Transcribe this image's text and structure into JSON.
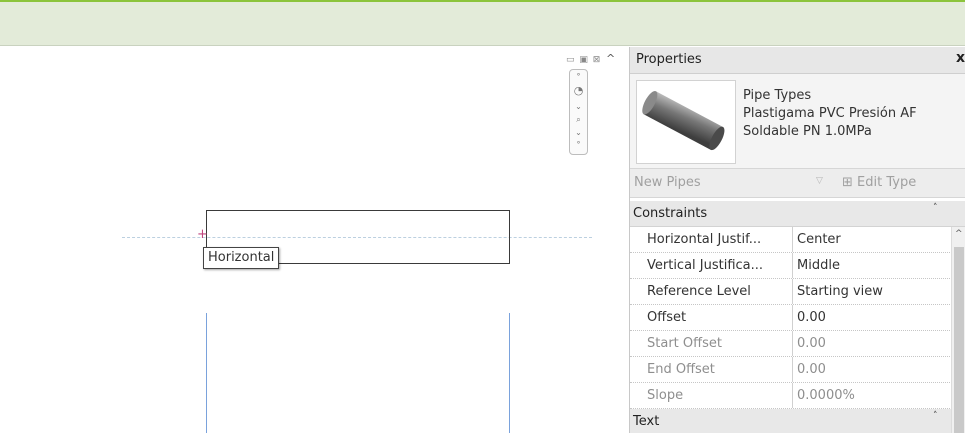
{
  "canvas": {
    "tooltip": "Horizontal",
    "window_controls": "▭ ▣ ⊠",
    "collapse_caret": "^"
  },
  "properties": {
    "title": "Properties",
    "close": "x",
    "type_selector": {
      "line1": "Pipe Types",
      "line2": "Plastigama PVC Presión AF",
      "line3": "Soldable PN 1.0MPa"
    },
    "filter": {
      "label": "New Pipes",
      "edit_type": "Edit Type"
    },
    "groups": [
      {
        "name": "Constraints",
        "rows": [
          {
            "label": "Horizontal Justif...",
            "value": "Center"
          },
          {
            "label": "Vertical Justifica...",
            "value": "Middle"
          },
          {
            "label": "Reference Level",
            "value": "Starting view"
          },
          {
            "label": "Offset",
            "value": "0.00"
          },
          {
            "label": "Start Offset",
            "value": "0.00"
          },
          {
            "label": "End Offset",
            "value": "0.00"
          },
          {
            "label": "Slope",
            "value": "0.0000%"
          }
        ]
      },
      {
        "name": "Text"
      }
    ]
  },
  "colors": {
    "topbar_accent": "#8cc43c",
    "guide_line": "#7aa2dc",
    "snap_marker": "#c0457e"
  }
}
